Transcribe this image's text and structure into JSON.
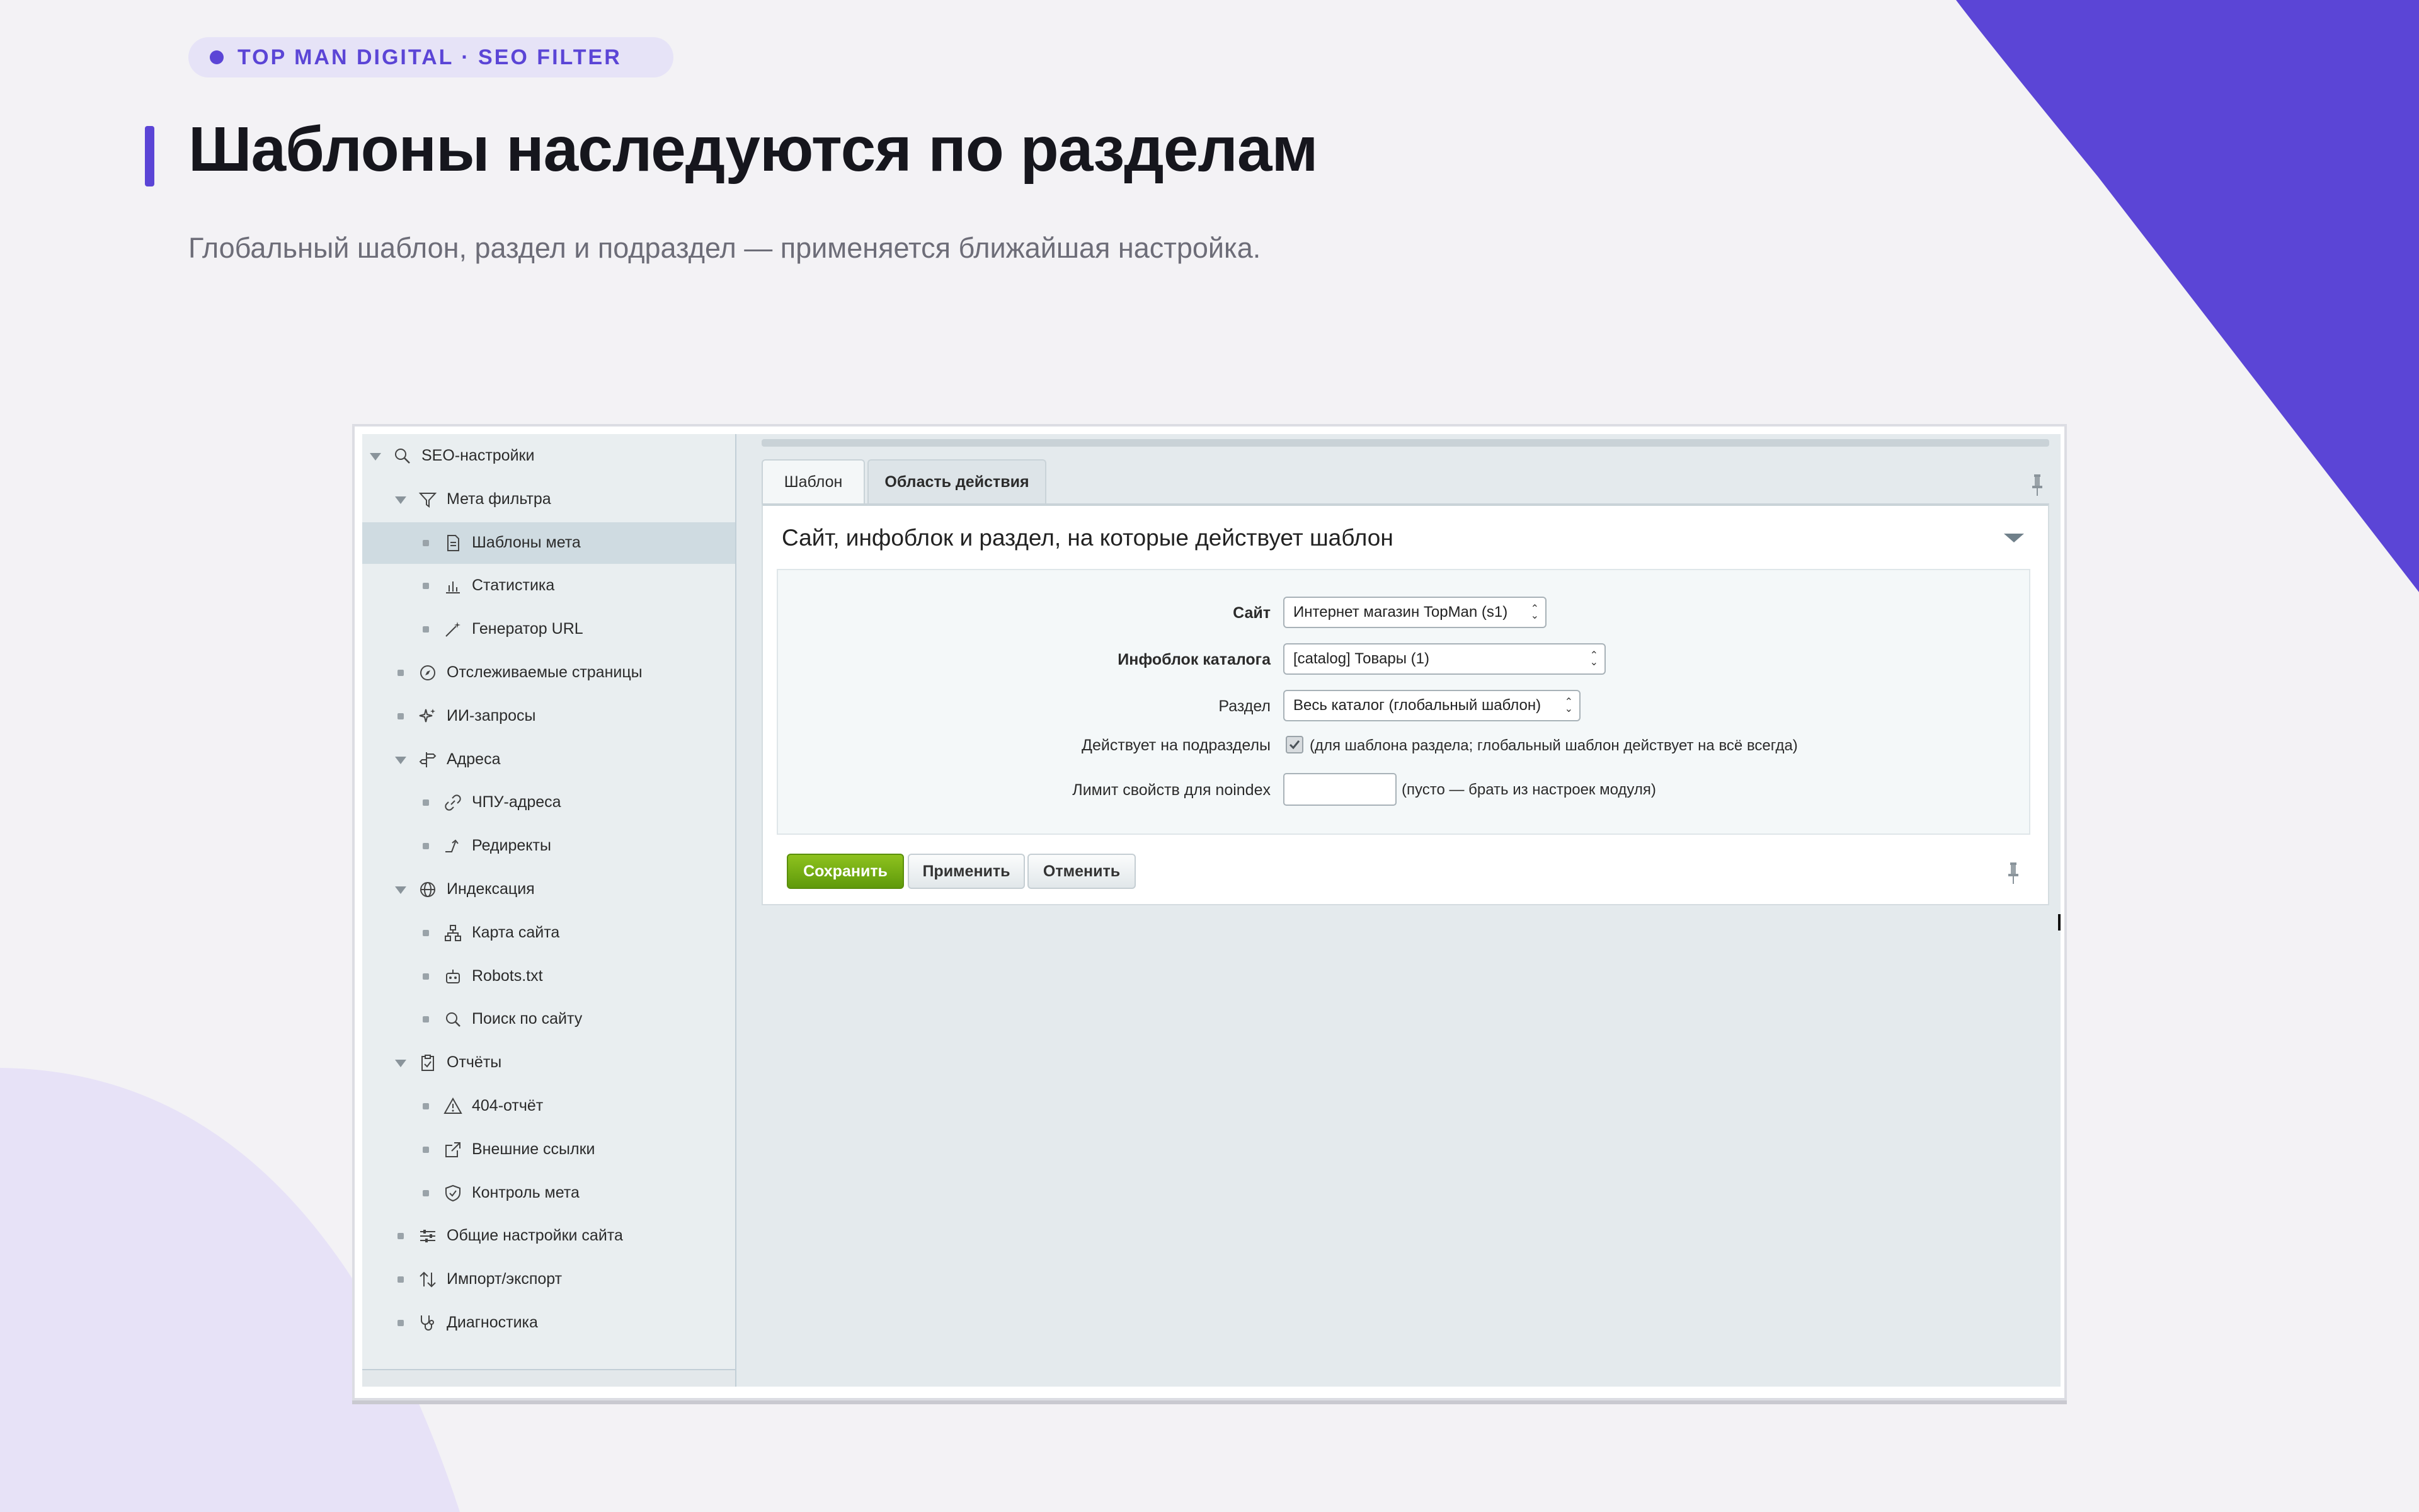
{
  "header": {
    "brand_pill": "TOP MAN DIGITAL · SEO FILTER",
    "title": "Шаблоны наследуются по разделам",
    "subtitle": "Глобальный шаблон, раздел и подраздел — применяется ближайшая настройка."
  },
  "sidebar": {
    "items": [
      {
        "label": "SEO-настройки",
        "icon": "seo-search-icon"
      },
      {
        "label": "Мета фильтра",
        "icon": "filter-icon"
      },
      {
        "label": "Шаблоны мета",
        "icon": "document-icon",
        "active": true
      },
      {
        "label": "Статистика",
        "icon": "bar-chart-icon"
      },
      {
        "label": "Генератор URL",
        "icon": "magic-wand-icon"
      },
      {
        "label": "Отслеживаемые страницы",
        "icon": "compass-icon"
      },
      {
        "label": "ИИ-запросы",
        "icon": "sparkles-icon"
      },
      {
        "label": "Адреса",
        "icon": "signpost-icon"
      },
      {
        "label": "ЧПУ-адреса",
        "icon": "link-icon"
      },
      {
        "label": "Редиректы",
        "icon": "redirect-arrow-icon"
      },
      {
        "label": "Индексация",
        "icon": "globe-icon"
      },
      {
        "label": "Карта сайта",
        "icon": "sitemap-icon"
      },
      {
        "label": "Robots.txt",
        "icon": "robot-icon"
      },
      {
        "label": "Поиск по сайту",
        "icon": "search-icon"
      },
      {
        "label": "Отчёты",
        "icon": "clipboard-icon"
      },
      {
        "label": "404-отчёт",
        "icon": "warning-icon"
      },
      {
        "label": "Внешние ссылки",
        "icon": "external-link-icon"
      },
      {
        "label": "Контроль мета",
        "icon": "shield-check-icon"
      },
      {
        "label": "Общие настройки сайта",
        "icon": "sliders-icon"
      },
      {
        "label": "Импорт/экспорт",
        "icon": "import-export-icon"
      },
      {
        "label": "Диагностика",
        "icon": "stethoscope-icon"
      }
    ]
  },
  "tabs": [
    {
      "label": "Шаблон"
    },
    {
      "label": "Область действия"
    }
  ],
  "panel": {
    "title": "Сайт, инфоблок и раздел, на которые действует шаблон",
    "fields": {
      "site_label": "Сайт",
      "site_value": "Интернет магазин TopMan (s1)",
      "iblock_label": "Инфоблок каталога",
      "iblock_value": "[catalog] Товары (1)",
      "section_label": "Раздел",
      "section_value": "Весь каталог (глобальный шаблон)",
      "subsections_label": "Действует на подразделы",
      "subsections_note": "(для шаблона раздела; глобальный шаблон действует на всё всегда)",
      "subsections_checked": true,
      "noindex_label": "Лимит свойств для noindex",
      "noindex_value": "",
      "noindex_note": "(пусто — брать из настроек модуля)"
    }
  },
  "buttons": {
    "save": "Сохранить",
    "apply": "Применить",
    "cancel": "Отменить"
  },
  "colors": {
    "accent": "#5b45d6",
    "save_button": "#6aa815",
    "background": "#f3f2f5"
  }
}
